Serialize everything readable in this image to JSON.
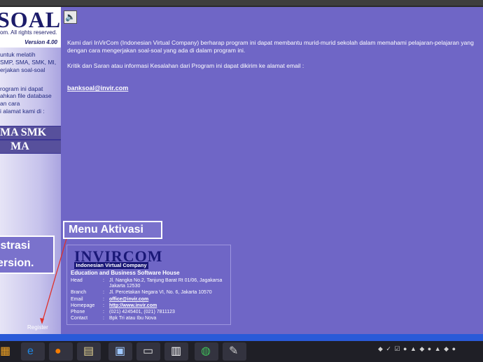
{
  "sidebar": {
    "logo_text": "SOAL",
    "copyright": "om. All rights reserved.",
    "version": "Version 4.00",
    "lines": [
      "untuk melatih",
      "SMP, SMA, SMK, MI,",
      "erjakan soal-soal",
      "rogram ini dapat",
      "ahkan file database",
      "an cara",
      "i alamat kami di :"
    ],
    "levels": [
      "MA  SMK",
      "MA"
    ],
    "register": "Register"
  },
  "content": {
    "speaker_icon": "speaker-icon",
    "paragraph1_line1": "Kami dari InVirCom (Indonesian Virtual Company) berharap program ini dapat membantu murid-murid sekolah dalam memahami pelajaran-pelajaran yang",
    "paragraph1_line2": "dengan cara mengerjakan soal-soal yang ada di dalam program ini.",
    "paragraph2": "Kritik dan Saran atau informasi Kesalahan dari Program ini dapat dikirim ke alamat email :",
    "email": "banksoal@invir.com"
  },
  "callouts": {
    "menu_aktivasi": "Menu Aktivasi",
    "reg_line1": "istrasi",
    "reg_line2": "ersion."
  },
  "company": {
    "brand": "INVIRCOM",
    "brand_sub": "Indonesian Virtual Company",
    "tagline": "Education and Business Software House",
    "rows": [
      {
        "label": "Head",
        "value": "Jl. Nangka No.2, Tanjung Barat Rt 01/06, Jagakarsa"
      },
      {
        "label": "",
        "value": "Jakarta 12530"
      },
      {
        "label": "Branch",
        "value": "Jl. Percetakan Negara VI, No. 6, Jakarta 10570"
      },
      {
        "label": "Email",
        "value": "office@invir.com"
      },
      {
        "label": "Homepage",
        "value": "http://www.invir.com"
      },
      {
        "label": "Phone",
        "value": "(021) 4245401, (021) 7811123"
      },
      {
        "label": "Contact",
        "value": "Bpk Tri atau Ibu Nova"
      }
    ],
    "colon": ":"
  },
  "taskbar": {
    "icons": [
      "windows-icon",
      "internet-explorer-icon",
      "firefox-icon",
      "notepad-icon",
      "paint-icon",
      "window-icon",
      "documents-icon",
      "globe-icon",
      "tools-icon"
    ],
    "tray_text": "◆ ✓ ☑ ● ▲ ◆ ● ▲ ◆ ●"
  },
  "colors": {
    "background": "#6f66c6",
    "sidebar": "#c7c3ec",
    "dark_blue": "#1a1877",
    "taskbar_strip": "#2a5ad8"
  }
}
